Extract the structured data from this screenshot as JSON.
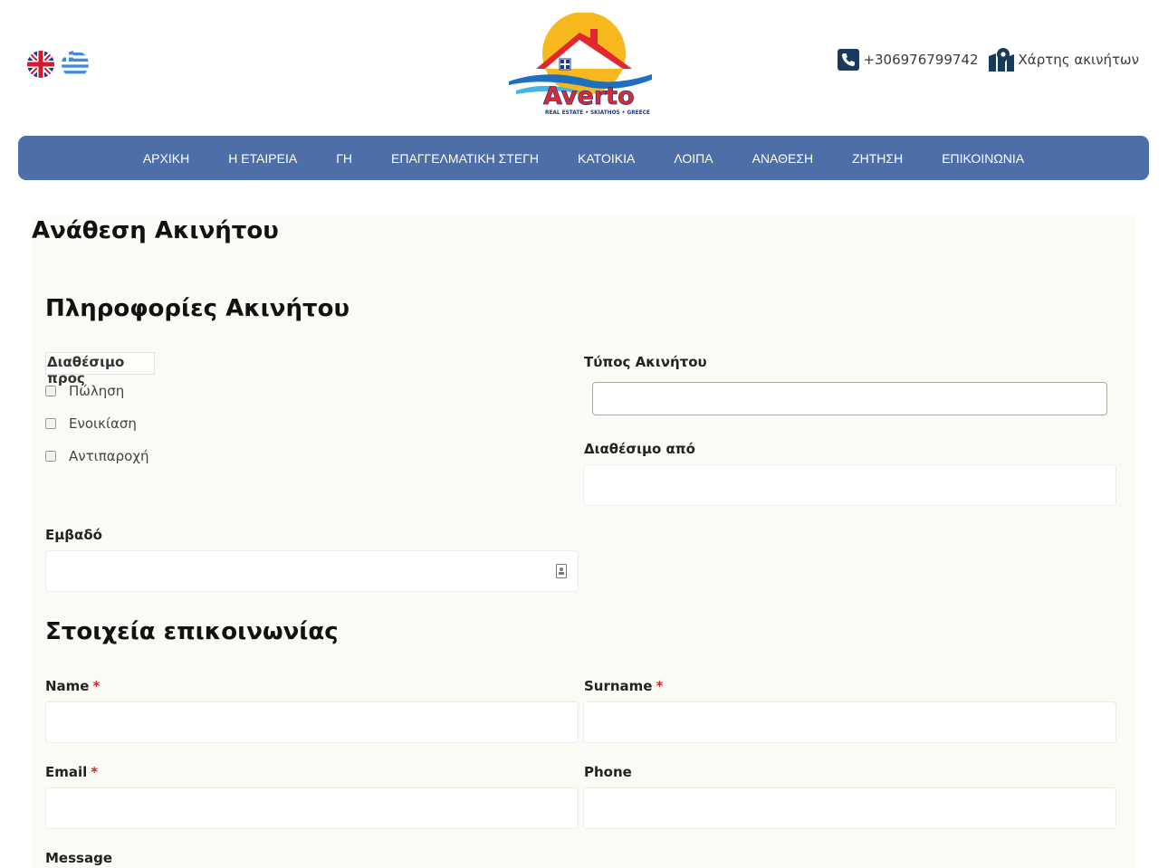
{
  "header": {
    "phone": "+306976799742",
    "map_link": "Χάρτης ακινήτων",
    "logo_text": "Averto",
    "logo_tagline": "REAL ESTATE • SKIATHOS • GREECE"
  },
  "nav": {
    "items": [
      "ΑΡΧΙΚΗ",
      "Η ΕΤΑΙΡΕΙΑ",
      "ΓΗ",
      "ΕΠΑΓΓΕΛΜΑΤΙΚΗ ΣΤΕΓΗ",
      "ΚΑΤΟΙΚΙΑ",
      "ΛΟΙΠΑ",
      "ΑΝΑΘΕΣΗ",
      "ΖΗΤΗΣΗ",
      "ΕΠΙΚΟΙΝΩΝΙΑ"
    ]
  },
  "page": {
    "title": "Ανάθεση Ακινήτου"
  },
  "property_section": {
    "title": "Πληροφορίες Ακινήτου",
    "available_for_label": "Διαθέσιμο προς",
    "options": [
      "Πώληση",
      "Ενοικίαση",
      "Αντιπαροχή"
    ],
    "type_label": "Τύπος Ακινήτου",
    "available_from_label": "Διαθέσιμο από",
    "area_label": "Εμβαδό"
  },
  "contact_section": {
    "title": "Στοιχεία επικοινωνίας",
    "name_label": "Name",
    "surname_label": "Surname",
    "email_label": "Email",
    "phone_label": "Phone",
    "message_label": "Message",
    "required_mark": "*"
  },
  "colors": {
    "nav_bg": "#4e6ea7",
    "content_bg": "#f9fbf4",
    "required": "#d0292d",
    "logo_red": "#e0282e",
    "logo_blue": "#1f6fbf",
    "logo_sun": "#f7b81e"
  }
}
